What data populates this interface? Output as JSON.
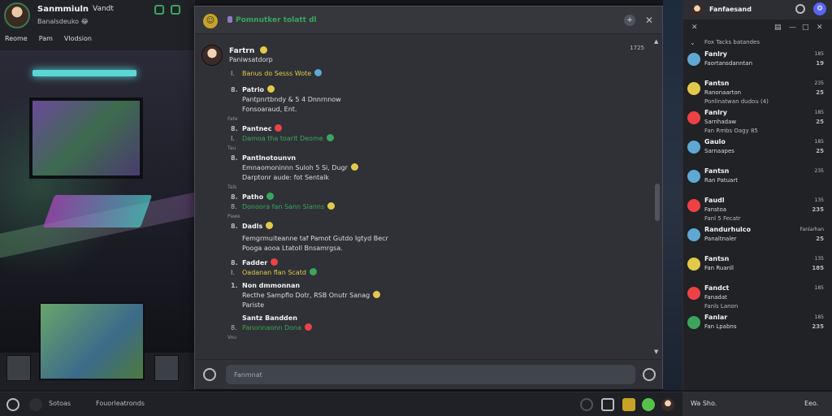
{
  "stream": {
    "streamer_name": "Sanmmiuln",
    "streamer_tag": "Vandt",
    "streamer_sub": "Banalsdeuko 😂",
    "nav": [
      "Reome",
      "Pam",
      "Vlodsion"
    ]
  },
  "chat": {
    "channel": "Pomnutker tolatt dl",
    "messages": [
      {
        "user": "Fartrn",
        "emoji": "yellow",
        "line1": "Paniwsatdorp",
        "line2": "Banus do Sesss Wote",
        "time": "1725"
      },
      {
        "user": "Patrio",
        "line1": "Pantpnrtbndy & 5 4 Dnnrnnow",
        "line2": "Fonsoaraud, Ent."
      },
      {
        "user": "Pantnec",
        "line1": "Damoa tha toarlt Deome",
        "color": "green"
      },
      {
        "user": "Pantlnotounvn",
        "line1": "Emnaomoninnn Suloh 5 Si, Dugr",
        "line2": "Darptonr aude: fot Sentalk"
      },
      {
        "user": "Patho",
        "line1": "Donoora fan Sann Slanns",
        "color": "green"
      },
      {
        "user": "Dadls",
        "line1": "Femgrmuiteanne taf Pamot Gutdo Igtyd Becr",
        "line2": "Pooga aooa Ltatoll Bnsamrgsa."
      },
      {
        "user": "Fadder",
        "line1": "Oadanan flan Scatd",
        "color": "yellow"
      },
      {
        "user": "Non dmmonnan",
        "line1": "Recthe Sampflo Dotr, RSB Onutr Sanag",
        "line2": "Pariste"
      },
      {
        "user": "Santz Bandden",
        "line1": "Panonnaonn Dona",
        "color": "green"
      }
    ],
    "small_labels": [
      "Fate",
      "Tau",
      "Tals",
      "Pawe",
      "Vou"
    ],
    "composer_placeholder": "Fanmnat"
  },
  "sidebar": {
    "user": "Fanfaesand",
    "section": "Fox Tacks batandes",
    "friends": [
      {
        "name": "Fanlry",
        "l2": "Faortansdanntan",
        "l3": "",
        "t1": "185",
        "t2": "19",
        "color": "blue"
      },
      {
        "name": "Fantsn",
        "l2": "Ranonaarton",
        "l3": "Ponlinatwan dudou (4)",
        "t1": "235",
        "t2": "25",
        "color": "yellow"
      },
      {
        "name": "Fanlry",
        "l2": "Sarnhadaw",
        "l3": "Fan Rmbs Oagy 85",
        "t1": "185",
        "t2": "25",
        "color": "red"
      },
      {
        "name": "Gaulo",
        "l2": "Sarnaapes",
        "l3": "",
        "t1": "185",
        "t2": "25",
        "color": "blue"
      },
      {
        "name": "Fantsn",
        "l2": "Ran Patuart",
        "l3": "",
        "t1": "235",
        "t2": "",
        "color": "blue"
      },
      {
        "name": "Faudl",
        "l2": "Fanstoa",
        "l3": "Fanl 5 Fecatr",
        "t1": "135",
        "t2": "235",
        "color": "red"
      },
      {
        "name": "Randurhulco",
        "l2": "Panaltnaler",
        "l3": "",
        "t1": "Fanlarhan",
        "t2": "25",
        "color": "blue"
      },
      {
        "name": "Fantsn",
        "l2": "Fan Ruanll",
        "l3": "",
        "t1": "135",
        "t2": "185",
        "color": "yellow"
      },
      {
        "name": "Fandct",
        "l2": "Fanadat",
        "l3": "Fanls Lanon",
        "t1": "185",
        "t2": "",
        "color": "red"
      },
      {
        "name": "Fanlar",
        "l2": "Fan Lpabns",
        "l3": "",
        "t1": "185",
        "t2": "235",
        "color": "green"
      }
    ],
    "bottom_left": "Wa Sho.",
    "bottom_right": "Eeo."
  },
  "bottombar": {
    "left_label": "Sotoas",
    "search_placeholder": "Fouorleatronds"
  }
}
